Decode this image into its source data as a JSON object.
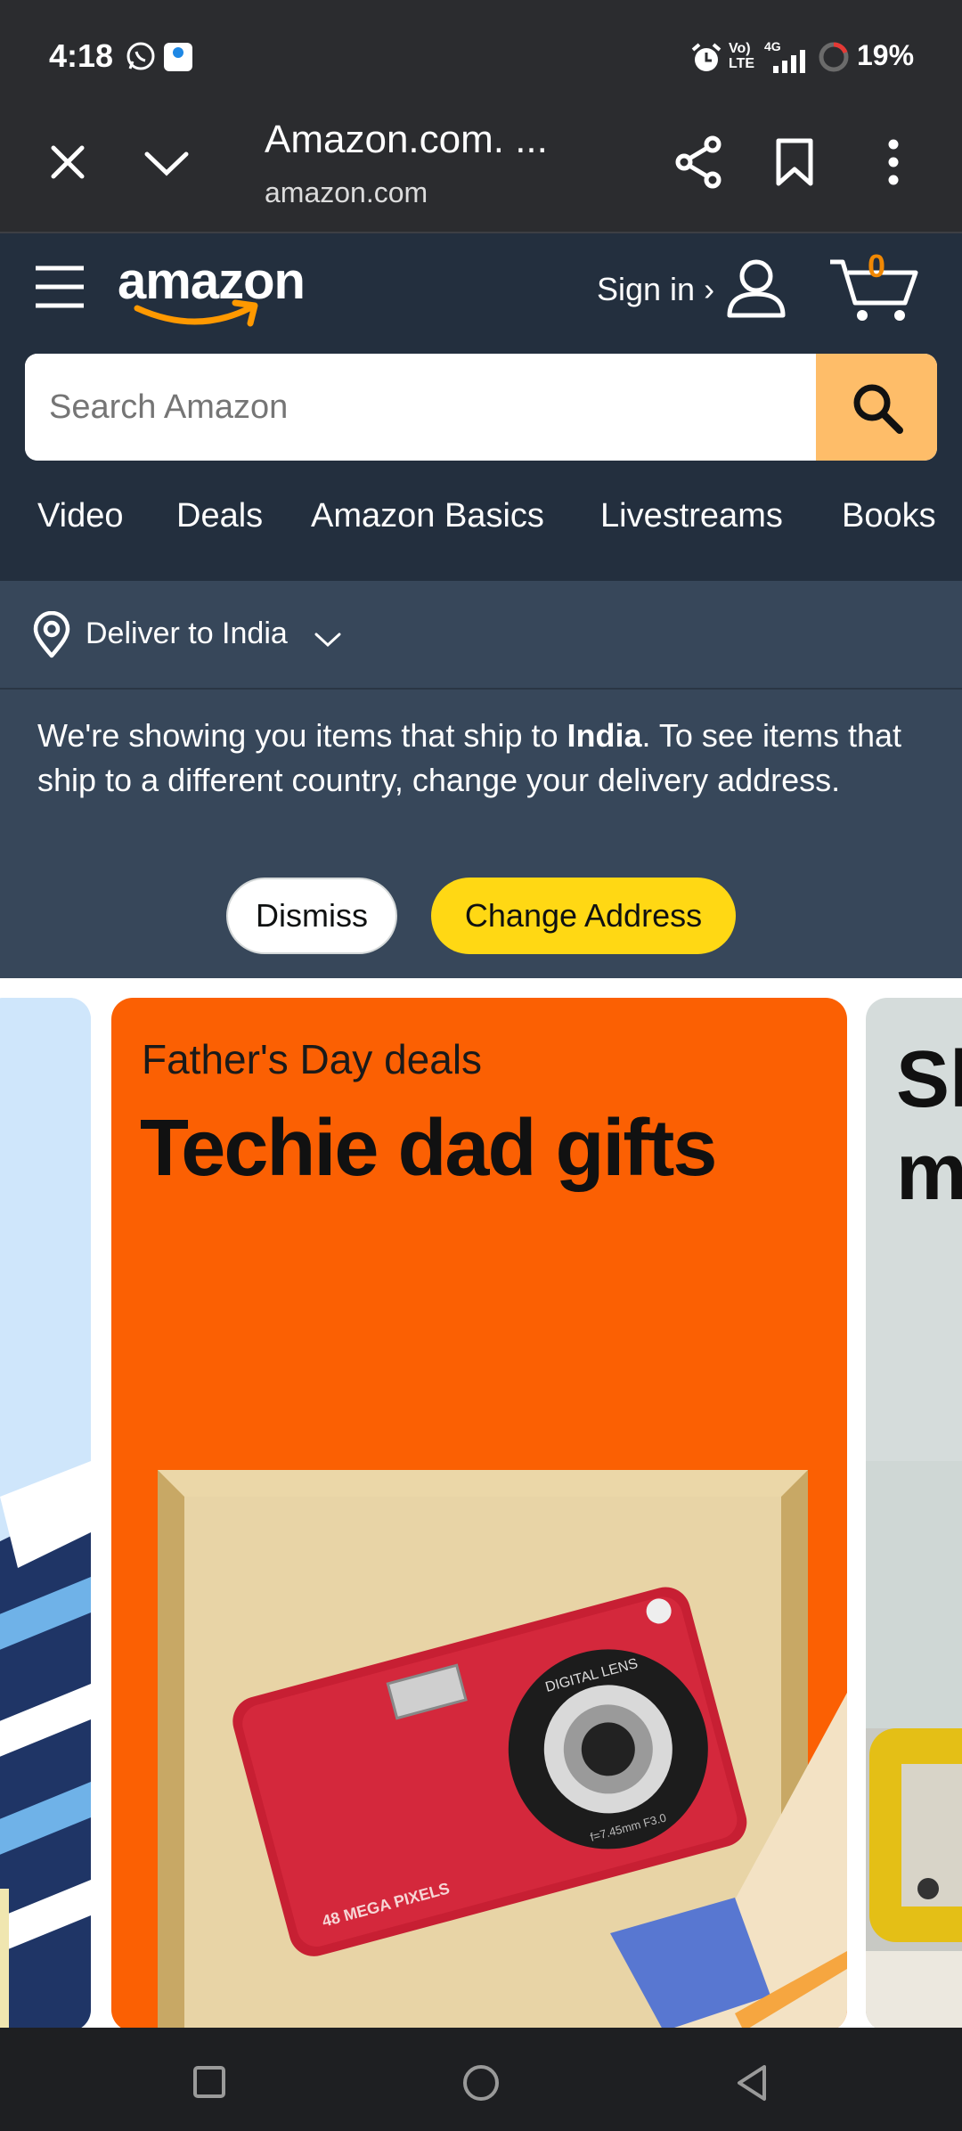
{
  "status_bar": {
    "time": "4:18",
    "battery": "19%",
    "icons": [
      "whatsapp-icon",
      "sim-card-app-icon",
      "alarm-icon",
      "volte-icon",
      "4g-signal-icon",
      "battery-ring-icon"
    ]
  },
  "browser": {
    "page_title": "Amazon.com. ...",
    "domain": "amazon.com"
  },
  "amazon": {
    "logo_text": "amazon",
    "sign_in": "Sign in ›",
    "cart_count": "0",
    "search_placeholder": "Search Amazon",
    "nav_links": [
      "Video",
      "Deals",
      "Amazon Basics",
      "Livestreams",
      "Books"
    ],
    "deliver_to": "Deliver to India",
    "notice_pre": "We're showing you items that ship to ",
    "notice_bold": "India",
    "notice_post": ". To see items that ship to a different country, change your delivery address.",
    "dismiss_label": "Dismiss",
    "change_address_label": "Change Address"
  },
  "carousel": {
    "main": {
      "kicker": "Father's Day deals",
      "headline": "Techie dad gifts",
      "camera_lens_text": "DIGITAL LENS",
      "camera_spec_text": "f=7.45mm F3.0",
      "camera_mp_text": "48 MEGA PIXELS"
    },
    "right_peek": "Sh\nm"
  },
  "colors": {
    "status_bg": "#2b2c2f",
    "amazon_header": "#232f3e",
    "subnav": "#37475a",
    "search_button": "#febd69",
    "change_button": "#ffd814",
    "promo_orange": "#fb6003",
    "cart_orange": "#f08804"
  }
}
